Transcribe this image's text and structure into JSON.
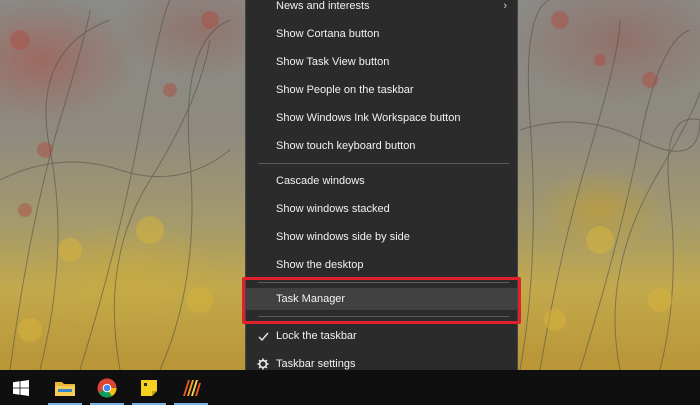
{
  "context_menu": {
    "items": [
      {
        "label": "News and interests",
        "has_submenu": true
      },
      {
        "label": "Show Cortana button"
      },
      {
        "label": "Show Task View button"
      },
      {
        "label": "Show People on the taskbar"
      },
      {
        "label": "Show Windows Ink Workspace button"
      },
      {
        "label": "Show touch keyboard button"
      },
      {
        "label": "Cascade windows"
      },
      {
        "label": "Show windows stacked"
      },
      {
        "label": "Show windows side by side"
      },
      {
        "label": "Show the desktop"
      },
      {
        "label": "Task Manager",
        "highlighted": true
      },
      {
        "label": "Lock the taskbar",
        "checked": true,
        "icon": "checkmark-icon"
      },
      {
        "label": "Taskbar settings",
        "icon": "gear-icon"
      }
    ]
  },
  "annotation": {
    "color": "#e0202c",
    "target": "Task Manager"
  },
  "taskbar": {
    "buttons": [
      {
        "name": "start-button",
        "icon": "windows-logo-icon"
      },
      {
        "name": "file-explorer-button",
        "icon": "folder-icon",
        "running": true
      },
      {
        "name": "chrome-button",
        "icon": "chrome-icon",
        "running": true
      },
      {
        "name": "sticky-notes-button",
        "icon": "sticky-notes-icon",
        "running": true
      },
      {
        "name": "app-button",
        "icon": "stripes-app-icon",
        "running": true
      }
    ],
    "accent_color": "#7ab4e6"
  }
}
